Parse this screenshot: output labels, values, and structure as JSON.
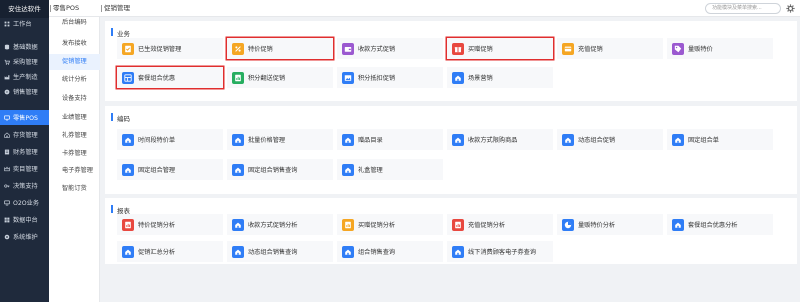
{
  "app": {
    "brand": "安住达软件"
  },
  "colors": {
    "accent": "#2f7df6",
    "sidebar_bg": "#1f2a3c",
    "highlight": "#e02e2e"
  },
  "sidebar": {
    "items": [
      {
        "label": "工作台",
        "icon": "grid-icon"
      },
      {
        "label": "基础数据",
        "icon": "database-icon"
      },
      {
        "label": "采购管理",
        "icon": "cart-icon"
      },
      {
        "label": "生产制造",
        "icon": "factory-icon"
      },
      {
        "label": "销售管理",
        "icon": "coin-icon"
      },
      {
        "label": "零售POS",
        "icon": "monitor-icon"
      },
      {
        "label": "存货管理",
        "icon": "home-icon"
      },
      {
        "label": "财务管理",
        "icon": "ledger-icon"
      },
      {
        "label": "奕目管理",
        "icon": "crown-icon"
      },
      {
        "label": "决策支持",
        "icon": "key-icon"
      },
      {
        "label": "O2O业务",
        "icon": "o2o-icon"
      },
      {
        "label": "数据中台",
        "icon": "data-icon"
      },
      {
        "label": "系统维护",
        "icon": "gear-icon"
      }
    ],
    "active_index": 5
  },
  "subnav": {
    "items": [
      "后台编码",
      "发布接收",
      "促销管理",
      "统计分析",
      "设备支持",
      "业绩管理",
      "礼券管理",
      "卡券管理",
      "电子券管理",
      "智能订货"
    ],
    "active_index": 2
  },
  "topbar": {
    "tabs": [
      "零售POS",
      "促销管理"
    ],
    "search_placeholder": "功能模块及菜单搜索...",
    "settings_icon": "settings-icon"
  },
  "sections": [
    {
      "title": "业务",
      "tiles": [
        {
          "label": "已生效促销管理",
          "icon": "check-doc-icon",
          "color": "#f5a623"
        },
        {
          "label": "特价促销",
          "icon": "percent-icon",
          "color": "#f5a623"
        },
        {
          "label": "收款方式促销",
          "icon": "wallet-icon",
          "color": "#9b59d0"
        },
        {
          "label": "买赠促销",
          "icon": "gift-icon",
          "color": "#e8483f"
        },
        {
          "label": "充值促销",
          "icon": "card-icon",
          "color": "#f5a623"
        },
        {
          "label": "量贩特价",
          "icon": "tag-icon",
          "color": "#9b59d0"
        },
        {
          "label": "套餐组合优惠",
          "icon": "bundle-icon",
          "color": "#2f7df6"
        },
        {
          "label": "积分翻送促销",
          "icon": "chart-doc-icon",
          "color": "#27ae60"
        },
        {
          "label": "积分抵扣促销",
          "icon": "image-icon",
          "color": "#2f7df6"
        },
        {
          "label": "场景营销",
          "icon": "home-icon",
          "color": "#2f7df6"
        }
      ]
    },
    {
      "title": "编码",
      "tiles": [
        {
          "label": "时间段特价单",
          "icon": "home-icon",
          "color": "#2f7df6"
        },
        {
          "label": "批量价格管理",
          "icon": "home-icon",
          "color": "#2f7df6"
        },
        {
          "label": "赠品目录",
          "icon": "home-icon",
          "color": "#2f7df6"
        },
        {
          "label": "收款方式限购商品",
          "icon": "home-icon",
          "color": "#2f7df6"
        },
        {
          "label": "动态组合促销",
          "icon": "home-icon",
          "color": "#2f7df6"
        },
        {
          "label": "固定组合单",
          "icon": "home-icon",
          "color": "#2f7df6"
        },
        {
          "label": "固定组合管理",
          "icon": "home-icon",
          "color": "#2f7df6"
        },
        {
          "label": "固定组合销售查询",
          "icon": "home-icon",
          "color": "#2f7df6"
        },
        {
          "label": "礼盒管理",
          "icon": "home-icon",
          "color": "#2f7df6"
        }
      ]
    },
    {
      "title": "报表",
      "tiles": [
        {
          "label": "特价促销分析",
          "icon": "chart-doc-icon",
          "color": "#e8483f"
        },
        {
          "label": "收款方式促销分析",
          "icon": "home-icon",
          "color": "#2f7df6"
        },
        {
          "label": "买赠促销分析",
          "icon": "chart-doc-icon",
          "color": "#f5a623"
        },
        {
          "label": "充值促销分析",
          "icon": "chart-doc-icon",
          "color": "#e8483f"
        },
        {
          "label": "量贩特价分析",
          "icon": "pie-icon",
          "color": "#2f7df6"
        },
        {
          "label": "套餐组合优惠分析",
          "icon": "home-icon",
          "color": "#2f7df6"
        },
        {
          "label": "促销汇总分析",
          "icon": "home-icon",
          "color": "#2f7df6"
        },
        {
          "label": "动态组合销售查询",
          "icon": "home-icon",
          "color": "#2f7df6"
        },
        {
          "label": "组合销售查询",
          "icon": "home-icon",
          "color": "#2f7df6"
        },
        {
          "label": "线下消费顾客电子券查询",
          "icon": "home-icon",
          "color": "#2f7df6"
        }
      ]
    }
  ],
  "highlighted_tiles": [
    "特价促销",
    "买赠促销",
    "套餐组合优惠"
  ]
}
